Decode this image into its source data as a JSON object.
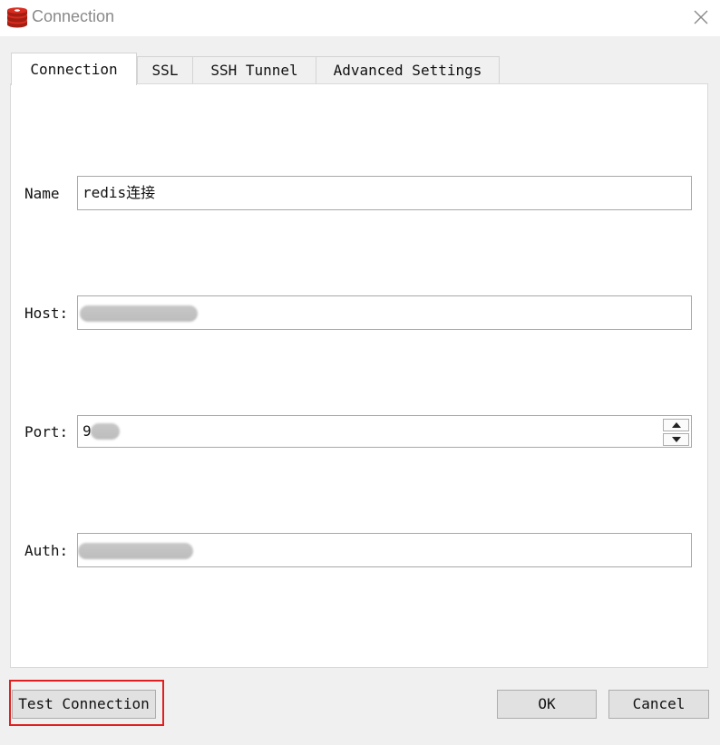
{
  "window": {
    "title": "Connection",
    "icon": "redis-icon",
    "close_icon": "close-icon"
  },
  "tabs": [
    {
      "label": "Connection",
      "active": true
    },
    {
      "label": "SSL",
      "active": false
    },
    {
      "label": "SSH Tunnel",
      "active": false
    },
    {
      "label": "Advanced Settings",
      "active": false
    }
  ],
  "form": {
    "name": {
      "label": "Name",
      "value": "redis连接"
    },
    "host": {
      "label": "Host:",
      "value": "",
      "redacted": true
    },
    "port": {
      "label": "Port:",
      "value": "9",
      "redacted": true
    },
    "auth": {
      "label": "Auth:",
      "value": "",
      "redacted": true
    }
  },
  "buttons": {
    "test_connection": "Test Connection",
    "ok": "OK",
    "cancel": "Cancel"
  },
  "colors": {
    "highlight": "#e02020",
    "redis_red": "#d82c20"
  }
}
